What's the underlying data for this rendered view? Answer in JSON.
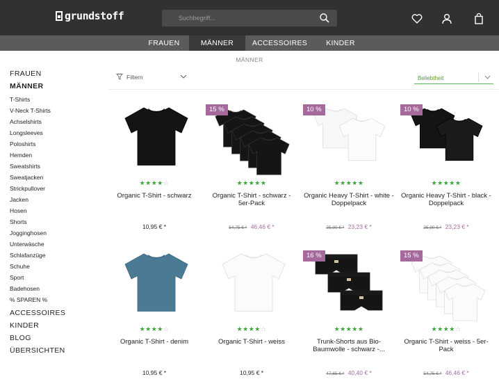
{
  "header": {
    "logo_text": "grundstoff",
    "search_placeholder": "Suchbegriff...",
    "icons": [
      "search-icon",
      "heart-icon",
      "user-icon",
      "bag-icon"
    ]
  },
  "catnav": [
    "FRAUEN",
    "MÄNNER",
    "ACCESSOIRES",
    "KINDER"
  ],
  "breadcrumb": "MÄNNER",
  "sidebar": {
    "top": [
      "FRAUEN",
      "MÄNNER"
    ],
    "sub": [
      "T-Shirts",
      "V-Neck T-Shirts",
      "Achselshirts",
      "Longsleeves",
      "Poloshirts",
      "Hemden",
      "Sweatshirts",
      "Sweatjacken",
      "Strickpullover",
      "Jacken",
      "Hosen",
      "Shorts",
      "Jogginghosen",
      "Unterwäsche",
      "Schlafanzüge",
      "Schuhe",
      "Sport",
      "Badehosen",
      "% SPAREN %"
    ],
    "bottom": [
      "ACCESSOIRES",
      "KINDER",
      "BLOG",
      "ÜBERSICHTEN"
    ]
  },
  "toolbar": {
    "filter_label": "Filtern",
    "sort_label": "Beliebtheit"
  },
  "colors": {
    "header": "#313131",
    "nav": "#5b5b5b",
    "badge": "#a5699b",
    "stars": "#3aa63a",
    "sort_accent": "#5cb85c"
  },
  "products": [
    {
      "name": "Organic T-Shirt - schwarz",
      "price": "10,95 € *",
      "old_price": "",
      "badge": "",
      "rating": 4,
      "half": false
    },
    {
      "name": "Organic T-Shirt - schwarz - 5er-Pack",
      "price": "46,46 € *",
      "old_price": "54,75 € *",
      "badge": "15 %",
      "rating": 4,
      "half": true
    },
    {
      "name": "Organic Heavy T-Shirt - white - Doppelpack",
      "price": "23,23 € *",
      "old_price": "25,90 € *",
      "badge": "10 %",
      "rating": 4,
      "half": true
    },
    {
      "name": "Organic Heavy T-Shirt - black - Doppelpack",
      "price": "23,23 € *",
      "old_price": "25,90 € *",
      "badge": "10 %",
      "rating": 4,
      "half": true
    },
    {
      "name": "Organic T-Shirt - denim",
      "price": "10,95 € *",
      "old_price": "",
      "badge": "",
      "rating": 4,
      "half": false
    },
    {
      "name": "Organic T-Shirt - weiss",
      "price": "10,95 € *",
      "old_price": "",
      "badge": "",
      "rating": 4,
      "half": false
    },
    {
      "name": "Trunk-Shorts aus Bio-Baumwolle - schwarz -...",
      "price": "40,40 € *",
      "old_price": "47,65 € *",
      "badge": "16 %",
      "rating": 4,
      "half": true
    },
    {
      "name": "Organic T-Shirt - weiss - 5er-Pack",
      "price": "46,46 € *",
      "old_price": "54,75 € *",
      "badge": "15 %",
      "rating": 4,
      "half": false
    }
  ]
}
